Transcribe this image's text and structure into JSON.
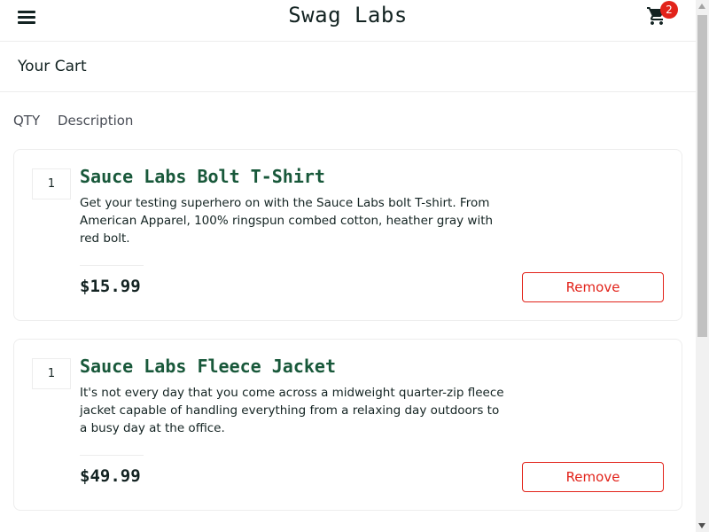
{
  "header": {
    "title": "Swag Labs",
    "menu_icon": "hamburger-menu-icon",
    "cart_icon": "shopping-cart-icon",
    "cart_count": "2"
  },
  "page": {
    "title": "Your Cart"
  },
  "columns": {
    "qty": "QTY",
    "description": "Description"
  },
  "cart": {
    "items": [
      {
        "quantity": "1",
        "name": "Sauce Labs Bolt T-Shirt",
        "description": "Get your testing superhero on with the Sauce Labs bolt T-shirt. From American Apparel, 100% ringspun combed cotton, heather gray with red bolt.",
        "price": "$15.99",
        "remove_label": "Remove"
      },
      {
        "quantity": "1",
        "name": "Sauce Labs Fleece Jacket",
        "description": "It's not every day that you come across a midweight quarter-zip fleece jacket capable of handling everything from a relaxing day outdoors to a busy day at the office.",
        "price": "$49.99",
        "remove_label": "Remove"
      }
    ]
  },
  "colors": {
    "accent_red": "#e2231a",
    "item_name_green": "#18583a",
    "text_dark": "#132322"
  }
}
